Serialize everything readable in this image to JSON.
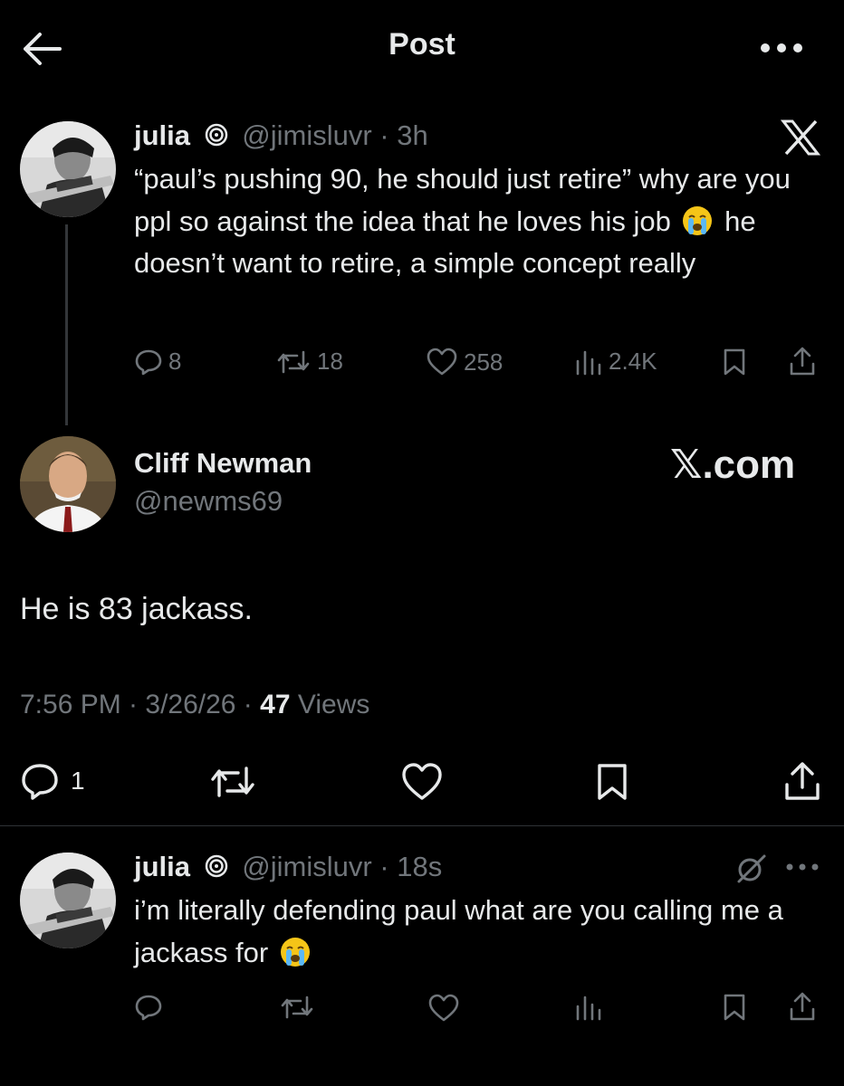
{
  "header": {
    "title": "Post"
  },
  "quoted": {
    "display_name": "julia",
    "handle": "@jimisluvr",
    "time": "· 3h",
    "text_1": "“paul’s pushing 90, he should just retire” why are you ppl so against the idea that he loves his job",
    "text_2": "he doesn’t want to retire, a simple concept really",
    "replies": "8",
    "reposts": "18",
    "likes": "258",
    "views": "2.4K"
  },
  "main": {
    "display_name": "Cliff Newman",
    "handle": "@newms69",
    "text": "He is 83 jackass.",
    "time": "7:56 PM · 3/26/26 ·",
    "views_count": "47",
    "views_label": "Views",
    "replies": "1"
  },
  "reply": {
    "display_name": "julia",
    "handle": "@jimisluvr",
    "time": "· 18s",
    "text": "i’m literally defending paul what are you calling me a jackass for"
  },
  "watermark": {
    "x_logo": "𝕏",
    "site": "𝕏.com"
  },
  "icons": [
    "back-arrow-icon",
    "more-icon",
    "verified-spiral-icon",
    "x-logo-icon",
    "reply-icon",
    "repost-icon",
    "like-icon",
    "views-icon",
    "bookmark-icon",
    "share-icon",
    "grok-icon",
    "crying-emoji-icon"
  ],
  "colors": {
    "background": "#000000",
    "text": "#e7e9ea",
    "secondary": "#71767b",
    "divider": "#2f3336"
  }
}
